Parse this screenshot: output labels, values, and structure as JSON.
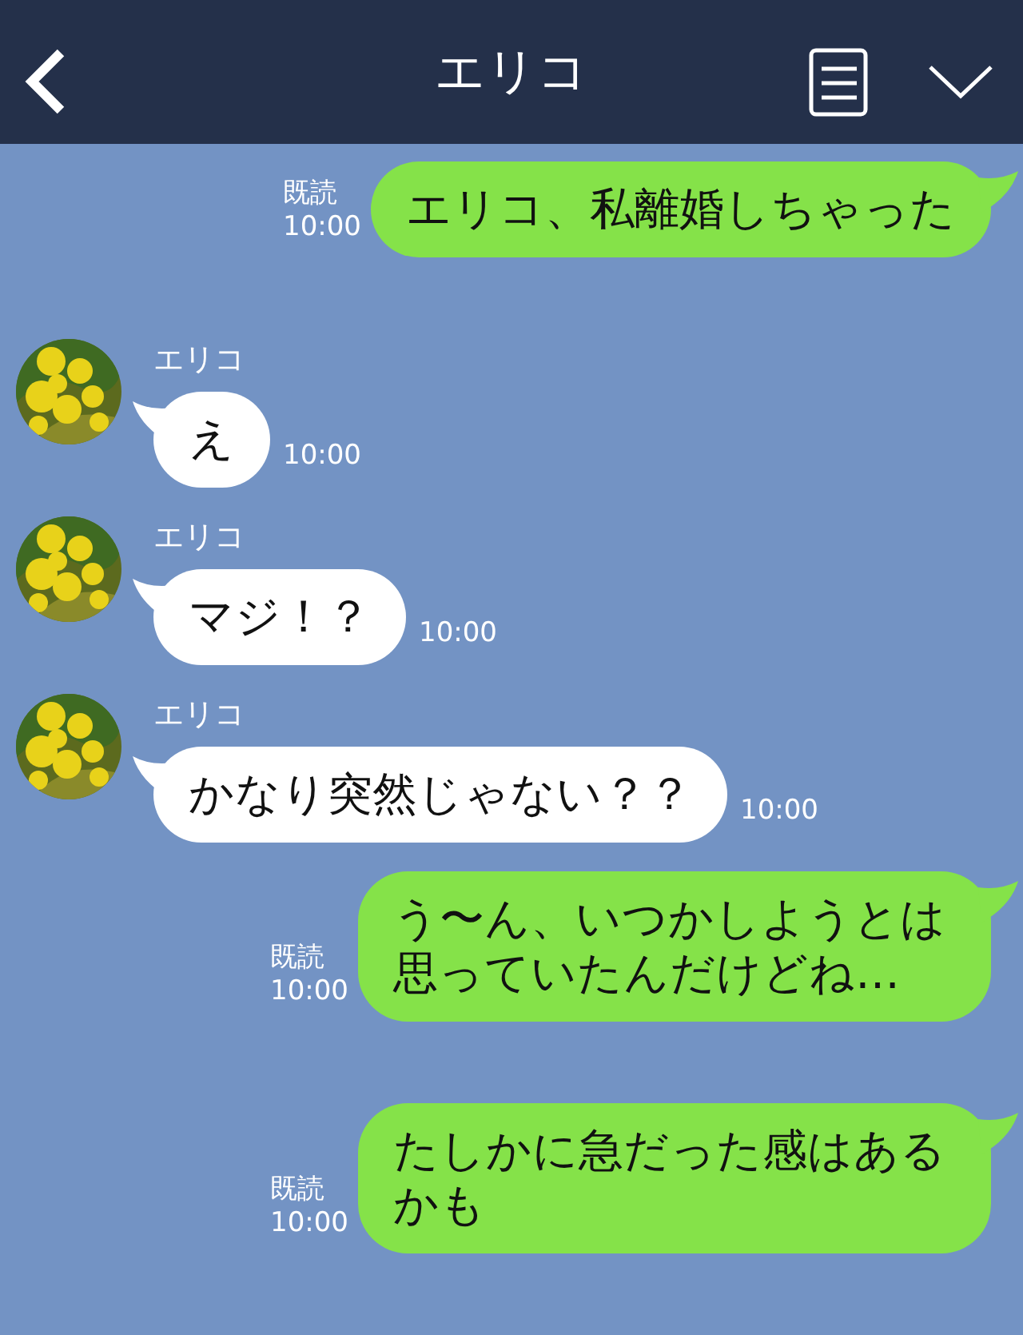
{
  "header": {
    "title": "エリコ"
  },
  "messages": [
    {
      "kind": "sent",
      "text": "エリコ、私離婚しちゃった",
      "read": "既読",
      "time": "10:00"
    },
    {
      "kind": "received",
      "sender": "エリコ",
      "text": "え",
      "time": "10:00"
    },
    {
      "kind": "received",
      "sender": "エリコ",
      "text": "マジ！？",
      "time": "10:00"
    },
    {
      "kind": "received",
      "sender": "エリコ",
      "text": "かなり突然じゃない？？",
      "time": "10:00"
    },
    {
      "kind": "sent",
      "text": "う〜ん、いつかしようとは思っていたんだけどね…",
      "read": "既読",
      "time": "10:00"
    },
    {
      "kind": "sent",
      "text": "たしかに急だった感はあるかも",
      "read": "既読",
      "time": "10:00"
    }
  ]
}
